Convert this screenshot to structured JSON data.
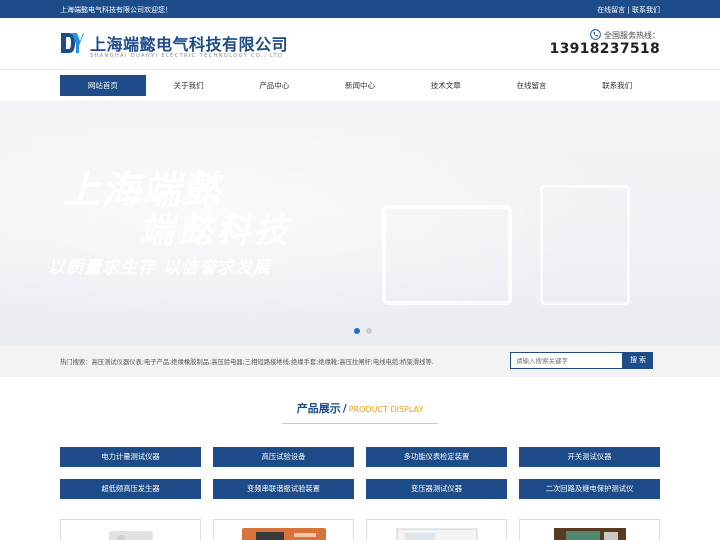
{
  "topbar": {
    "welcome": "上海端懿电气科技有限公司欢迎您！",
    "link_message": "在线留言",
    "link_sep": " | ",
    "link_contact": "联系我们"
  },
  "header": {
    "company_cn": "上海端懿电气科技有限公司",
    "company_en": "SHANGHAI DUANYI ELECTRIC TECHNOLOGY CO., LTD",
    "hotline_label": "全国服务热线：",
    "hotline_number": "13918237518"
  },
  "nav": {
    "items": [
      {
        "label": "网站首页",
        "active": true
      },
      {
        "label": "关于我们",
        "active": false
      },
      {
        "label": "产品中心",
        "active": false
      },
      {
        "label": "新闻中心",
        "active": false
      },
      {
        "label": "技术文章",
        "active": false
      },
      {
        "label": "在线留言",
        "active": false
      },
      {
        "label": "联系我们",
        "active": false
      }
    ]
  },
  "banner": {
    "line1": "上海端懿",
    "line2": "端懿科技",
    "line3": "以质量求生存 以信誉求发展",
    "active_slide": 1,
    "slide_count": 2
  },
  "search": {
    "hot_label": "热门搜索：",
    "hot_terms": "高压测试仪器仪表;电子产品;绝缘橡胶制品;高压验电器;三相短路接地线;绝缘手套;绝缘靴;高压拉闸杆;电线电缆;桥架滑线等.",
    "placeholder": "请输入搜索关键字",
    "button": "搜 索"
  },
  "products": {
    "title_cn": "产品展示",
    "title_sep": "/",
    "title_en": "PRODUCT DISPLAY",
    "categories": [
      "电力计量测试仪器",
      "高压试验设备",
      "多功能仪表检定装置",
      "开关测试仪器",
      "超低频高压发生器",
      "变频串联谐振试验装置",
      "变压器测试仪器",
      "二次回路及继电保护测试仪"
    ]
  },
  "colors": {
    "brand_blue": "#1d4c89",
    "accent_orange": "#e6a21a",
    "dot_active": "#1d6fd0"
  }
}
